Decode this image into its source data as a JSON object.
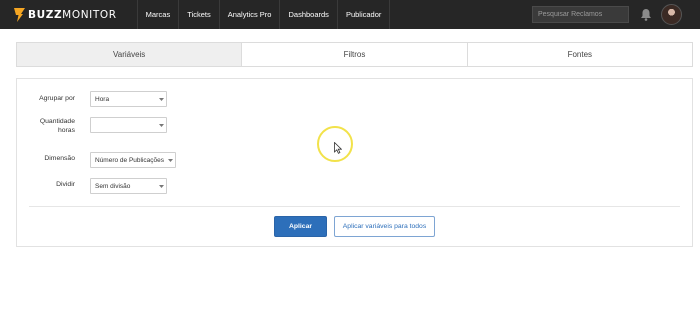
{
  "brand": {
    "name_part1": "BUZZ",
    "name_part2": "MONITOR",
    "icon": "buzzmonitor-logo-icon"
  },
  "nav": {
    "items": [
      {
        "label": "Marcas"
      },
      {
        "label": "Tickets"
      },
      {
        "label": "Analytics Pro"
      },
      {
        "label": "Dashboards"
      },
      {
        "label": "Publicador"
      }
    ],
    "search_placeholder": "Pesquisar Reclamos",
    "bell_icon": "bell-icon",
    "avatar_icon": "user-avatar"
  },
  "tabs": [
    {
      "label": "Variáveis",
      "active": true
    },
    {
      "label": "Filtros",
      "active": false
    },
    {
      "label": "Fontes",
      "active": false
    }
  ],
  "form": {
    "group_by": {
      "label": "Agrupar por",
      "value": "Hora"
    },
    "hours_qty": {
      "label_line1": "Quantidade",
      "label_line2": "horas",
      "value": ""
    },
    "dimension": {
      "label": "Dimensão",
      "value": "Número de Publicações"
    },
    "split": {
      "label": "Dividir",
      "value": "Sem divisão"
    }
  },
  "actions": {
    "apply": "Aplicar",
    "apply_all": "Aplicar variáveis para todos"
  },
  "colors": {
    "topbar": "#262626",
    "accent": "#2d6fba",
    "cursor_highlight": "#f2e24a",
    "logo_accent": "#f5a623"
  }
}
